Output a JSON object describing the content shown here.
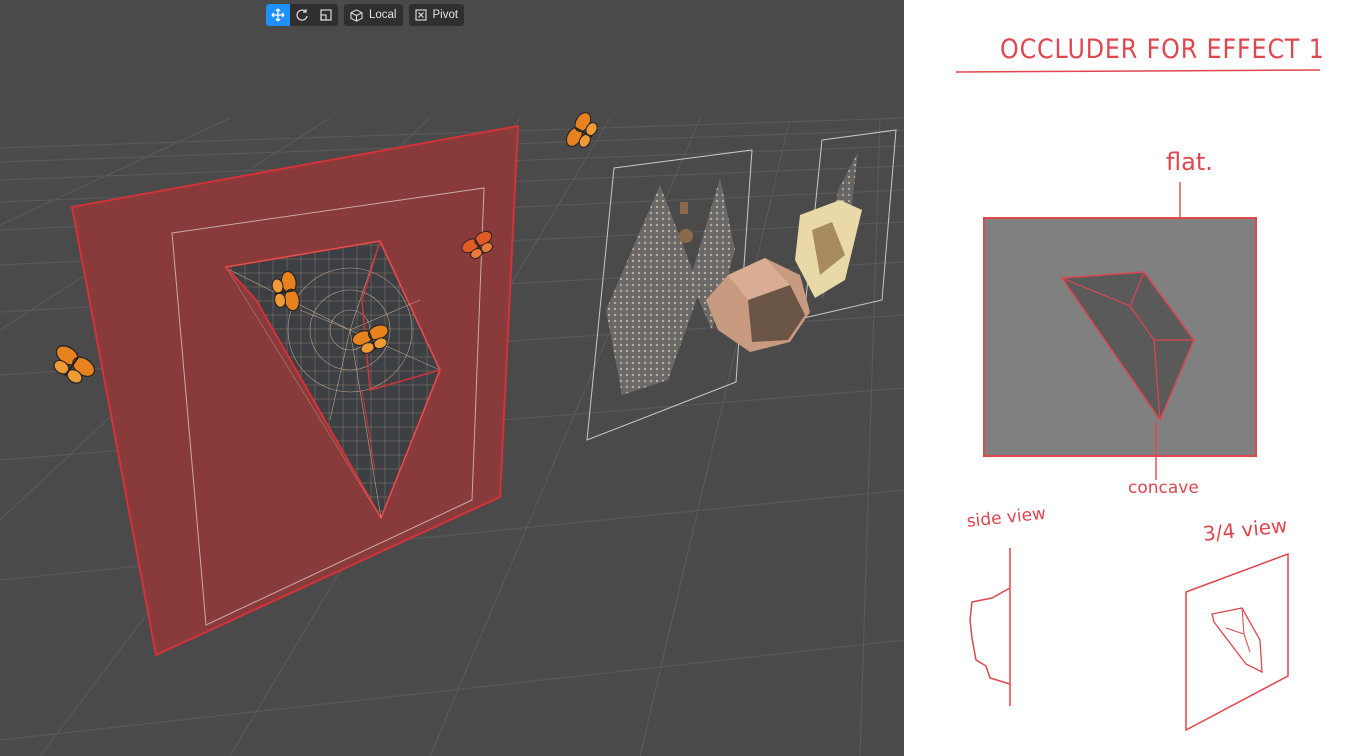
{
  "toolbar": {
    "tools": [
      {
        "name": "move",
        "icon": "move-icon",
        "active": true
      },
      {
        "name": "rotate",
        "icon": "rotate-icon",
        "active": false
      },
      {
        "name": "scale",
        "icon": "scale-icon",
        "active": false
      }
    ],
    "space_label": "Local",
    "space_icon": "cube-icon",
    "pivot_label": "Pivot",
    "pivot_icon": "pivot-icon",
    "active_color": "#1e90ff"
  },
  "sketch": {
    "title": "OCCLUDER  FOR  EFFECT 1",
    "label_flat": "flat.",
    "label_concave": "concave",
    "label_side_view": "side view",
    "label_three_quarter_view": "3/4 view",
    "ink_color": "#e0464e"
  },
  "scene": {
    "occluder_color": "#c0272d",
    "butterfly_color": "#e8821e",
    "grid_color": "#5a5a5a"
  }
}
